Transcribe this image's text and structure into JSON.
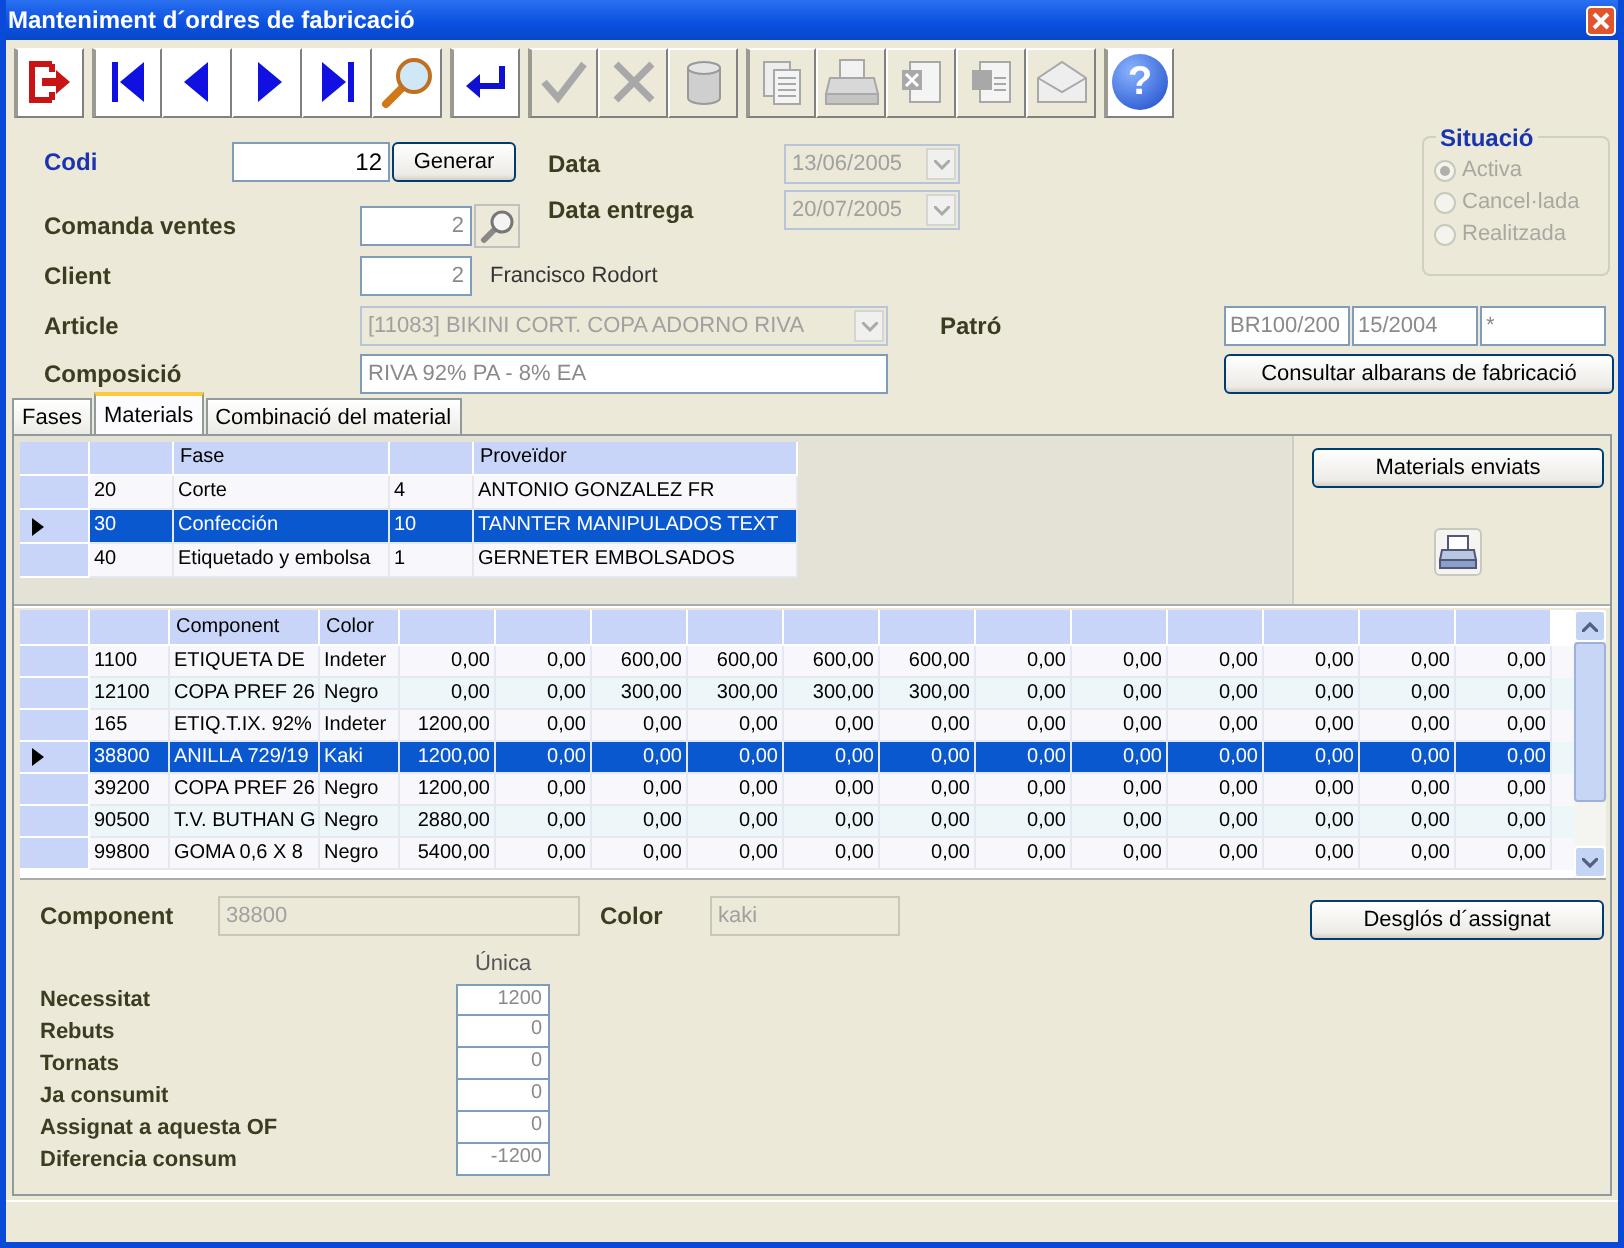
{
  "window": {
    "title": "Manteniment d´ordres de fabricació"
  },
  "toolbar": [
    {
      "kind": "exit",
      "group_start": true,
      "disabled": false
    },
    {
      "kind": "first",
      "group_start": true,
      "disabled": false
    },
    {
      "kind": "prev",
      "group_start": false,
      "disabled": false
    },
    {
      "kind": "next",
      "group_start": false,
      "disabled": false
    },
    {
      "kind": "last",
      "group_start": false,
      "disabled": false
    },
    {
      "kind": "search",
      "group_start": false,
      "disabled": false
    },
    {
      "kind": "enter",
      "group_start": true,
      "disabled": false
    },
    {
      "kind": "accept",
      "group_start": true,
      "disabled": true
    },
    {
      "kind": "cancel",
      "group_start": false,
      "disabled": true
    },
    {
      "kind": "database",
      "group_start": false,
      "disabled": true
    },
    {
      "kind": "copy",
      "group_start": true,
      "disabled": true
    },
    {
      "kind": "print",
      "group_start": false,
      "disabled": true
    },
    {
      "kind": "excel",
      "group_start": false,
      "disabled": true
    },
    {
      "kind": "word",
      "group_start": false,
      "disabled": true
    },
    {
      "kind": "mail",
      "group_start": false,
      "disabled": true
    },
    {
      "kind": "help",
      "group_start": true,
      "disabled": false,
      "glyph": "?"
    }
  ],
  "form": {
    "codi": {
      "label": "Codi",
      "value": "12"
    },
    "generate_button": "Generar",
    "data": {
      "label": "Data",
      "value": "13/06/2005"
    },
    "data_entrega": {
      "label": "Data entrega",
      "value": "20/07/2005"
    },
    "comanda_ventes": {
      "label": "Comanda ventes",
      "value": "2"
    },
    "client": {
      "label": "Client",
      "value": "2",
      "name": "Francisco Rodort"
    },
    "article": {
      "label": "Article",
      "value": "[11083] BIKINI CORT. COPA ADORNO RIVA"
    },
    "patro": {
      "label": "Patró",
      "values": [
        "BR100/200",
        "15/2004",
        "*"
      ]
    },
    "composicio": {
      "label": "Composició",
      "value": "RIVA 92% PA - 8% EA"
    },
    "consult_button": "Consultar albarans de fabricació"
  },
  "situacio": {
    "title": "Situació",
    "options": [
      {
        "label": "Activa",
        "selected": true
      },
      {
        "label": "Cancel·lada",
        "selected": false
      },
      {
        "label": "Realitzada",
        "selected": false
      }
    ]
  },
  "tabs": [
    {
      "label": "Fases",
      "selected": false
    },
    {
      "label": "Materials",
      "selected": true
    },
    {
      "label": "Combinació del material",
      "selected": false
    }
  ],
  "phases_table": {
    "columns": [
      {
        "kind": "blank"
      },
      {
        "kind": "label",
        "label": "Fase"
      },
      {
        "kind": "blank"
      },
      {
        "kind": "label",
        "label": "Proveïdor"
      }
    ],
    "rows": [
      {
        "cells": [
          "20",
          "Corte",
          "4",
          "ANTONIO GONZALEZ FR"
        ],
        "selected": false
      },
      {
        "cells": [
          "30",
          "Confección",
          "10",
          "TANNTER MANIPULADOS TEXT"
        ],
        "selected": true
      },
      {
        "cells": [
          "40",
          "Etiquetado y embolsa",
          "1",
          "GERNETER EMBOLSADOS"
        ],
        "selected": false
      }
    ]
  },
  "materials_sent_button": "Materials enviats",
  "components_table": {
    "columns": [
      {
        "kind": "blank"
      },
      {
        "kind": "label",
        "label": "Component"
      },
      {
        "kind": "label",
        "label": "Color"
      },
      {
        "kind": "blank"
      },
      {
        "kind": "blank"
      },
      {
        "kind": "blank"
      },
      {
        "kind": "blank"
      },
      {
        "kind": "blank"
      },
      {
        "kind": "blank"
      },
      {
        "kind": "blank"
      },
      {
        "kind": "blank"
      },
      {
        "kind": "blank"
      },
      {
        "kind": "blank"
      },
      {
        "kind": "blank"
      },
      {
        "kind": "blank"
      }
    ],
    "rows": [
      {
        "cells": [
          "1100",
          "ETIQUETA DE",
          "Indeter",
          "0,00",
          "0,00",
          "600,00",
          "600,00",
          "600,00",
          "600,00",
          "0,00",
          "0,00",
          "0,00",
          "0,00",
          "0,00",
          "0,00"
        ],
        "selected": false
      },
      {
        "cells": [
          "12100",
          "COPA PREF 26",
          "Negro",
          "0,00",
          "0,00",
          "300,00",
          "300,00",
          "300,00",
          "300,00",
          "0,00",
          "0,00",
          "0,00",
          "0,00",
          "0,00",
          "0,00"
        ],
        "selected": false
      },
      {
        "cells": [
          "165",
          "ETIQ.T.IX. 92%",
          "Indeter",
          "1200,00",
          "0,00",
          "0,00",
          "0,00",
          "0,00",
          "0,00",
          "0,00",
          "0,00",
          "0,00",
          "0,00",
          "0,00",
          "0,00"
        ],
        "selected": false
      },
      {
        "cells": [
          "38800",
          "ANILLA 729/19",
          "Kaki",
          "1200,00",
          "0,00",
          "0,00",
          "0,00",
          "0,00",
          "0,00",
          "0,00",
          "0,00",
          "0,00",
          "0,00",
          "0,00",
          "0,00"
        ],
        "selected": true
      },
      {
        "cells": [
          "39200",
          "COPA PREF 26",
          "Negro",
          "1200,00",
          "0,00",
          "0,00",
          "0,00",
          "0,00",
          "0,00",
          "0,00",
          "0,00",
          "0,00",
          "0,00",
          "0,00",
          "0,00"
        ],
        "selected": false
      },
      {
        "cells": [
          "90500",
          "T.V. BUTHAN G",
          "Negro",
          "2880,00",
          "0,00",
          "0,00",
          "0,00",
          "0,00",
          "0,00",
          "0,00",
          "0,00",
          "0,00",
          "0,00",
          "0,00",
          "0,00"
        ],
        "selected": false
      },
      {
        "cells": [
          "99800",
          "GOMA 0,6 X 8",
          "Negro",
          "5400,00",
          "0,00",
          "0,00",
          "0,00",
          "0,00",
          "0,00",
          "0,00",
          "0,00",
          "0,00",
          "0,00",
          "0,00",
          "0,00"
        ],
        "selected": false
      }
    ]
  },
  "detail": {
    "component": {
      "label": "Component",
      "value": "38800"
    },
    "color": {
      "label": "Color",
      "value": "kaki"
    },
    "breakdown_button": "Desglós d´assignat",
    "column": "Única",
    "rows": [
      {
        "label": "Necessitat",
        "value": "1200"
      },
      {
        "label": "Rebuts",
        "value": "0"
      },
      {
        "label": "Tornats",
        "value": "0"
      },
      {
        "label": "Ja consumit",
        "value": "0"
      },
      {
        "label": "Assignat a aquesta OF",
        "value": "0"
      },
      {
        "label": "Diferencia consum",
        "value": "-1200"
      }
    ]
  }
}
